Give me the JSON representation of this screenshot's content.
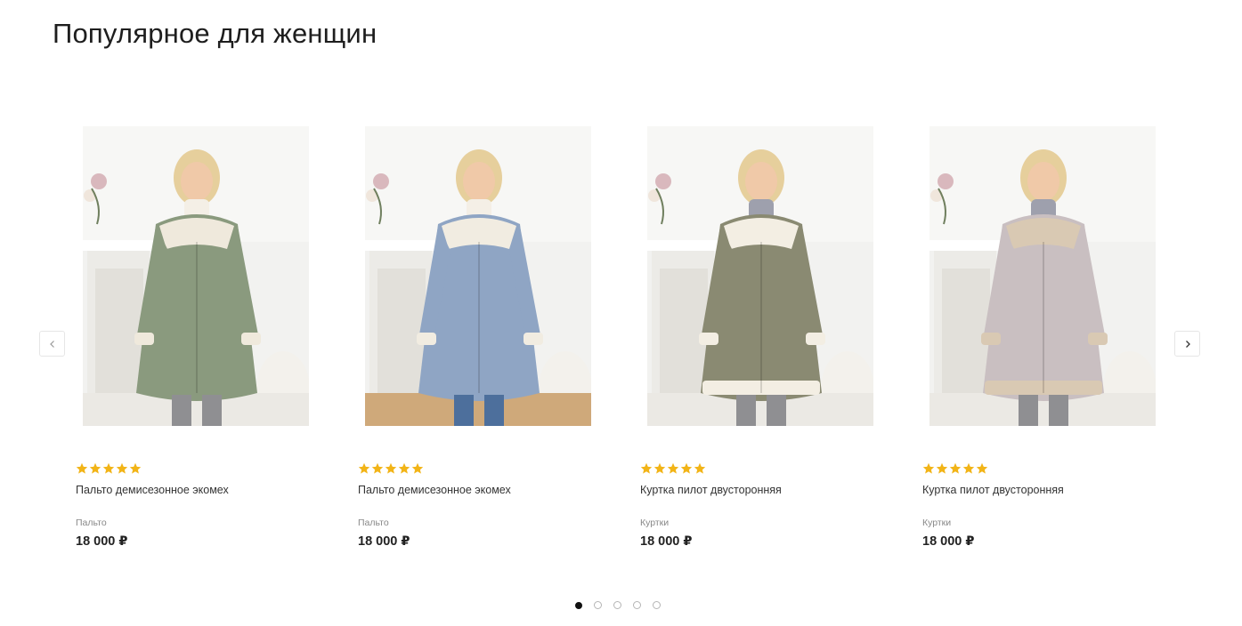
{
  "section": {
    "title": "Популярное для женщин"
  },
  "products": [
    {
      "name": "Пальто демисезонное экомех",
      "category": "Пальто",
      "price": "18 000 ₽",
      "rating": 5,
      "image_icon": "product-photo-green-coat",
      "coat_color": "#8a9a7e",
      "collar_color": "#efe9dc"
    },
    {
      "name": "Пальто демисезонное экомех",
      "category": "Пальто",
      "price": "18 000 ₽",
      "rating": 5,
      "image_icon": "product-photo-blue-coat",
      "coat_color": "#8fa5c4",
      "collar_color": "#f1ece1"
    },
    {
      "name": "Куртка пилот двусторонняя",
      "category": "Куртки",
      "price": "18 000 ₽",
      "rating": 5,
      "image_icon": "product-photo-green-jacket",
      "coat_color": "#8a8a72",
      "collar_color": "#f3eee3"
    },
    {
      "name": "Куртка пилот двусторонняя",
      "category": "Куртки",
      "price": "18 000 ₽",
      "rating": 5,
      "image_icon": "product-photo-lilac-jacket",
      "coat_color": "#c9bfc1",
      "collar_color": "#d9c9b3"
    }
  ],
  "navigation": {
    "prev_icon": "chevron-left-icon",
    "next_icon": "chevron-right-icon",
    "page_count": 5,
    "active_page": 1
  },
  "colors": {
    "star": "#f2b417",
    "title": "#1e1e1e",
    "price": "#222222"
  }
}
